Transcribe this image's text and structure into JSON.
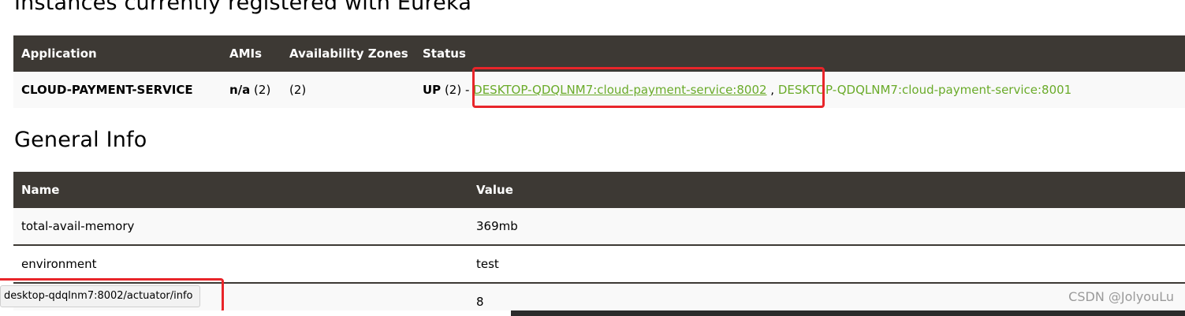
{
  "instances": {
    "heading": "Instances currently registered with Eureka",
    "columns": [
      "Application",
      "AMIs",
      "Availability Zones",
      "Status"
    ],
    "row": {
      "application": "CLOUD-PAYMENT-SERVICE",
      "amis_bold": "n/a",
      "amis_count": " (2)",
      "zones": "(2)",
      "status_bold": "UP",
      "status_rest": " (2) - ",
      "link_8002": "DESKTOP-QDQLNM7:cloud-payment-service:8002",
      "separator": " , ",
      "link_8001": "DESKTOP-QDQLNM7:cloud-payment-service:8001"
    }
  },
  "general": {
    "heading": "General Info",
    "columns": [
      "Name",
      "Value"
    ],
    "rows": [
      {
        "name": "total-avail-memory",
        "value": "369mb"
      },
      {
        "name": "environment",
        "value": "test"
      },
      {
        "name": "",
        "value": "8"
      }
    ]
  },
  "status_bar": {
    "url": "desktop-qdqlnm7:8002/actuator/info"
  },
  "watermark": "CSDN @JolyouLu",
  "colors": {
    "table_header": "#3d3934",
    "link": "#6aab2a",
    "highlight": "#e8252a"
  }
}
